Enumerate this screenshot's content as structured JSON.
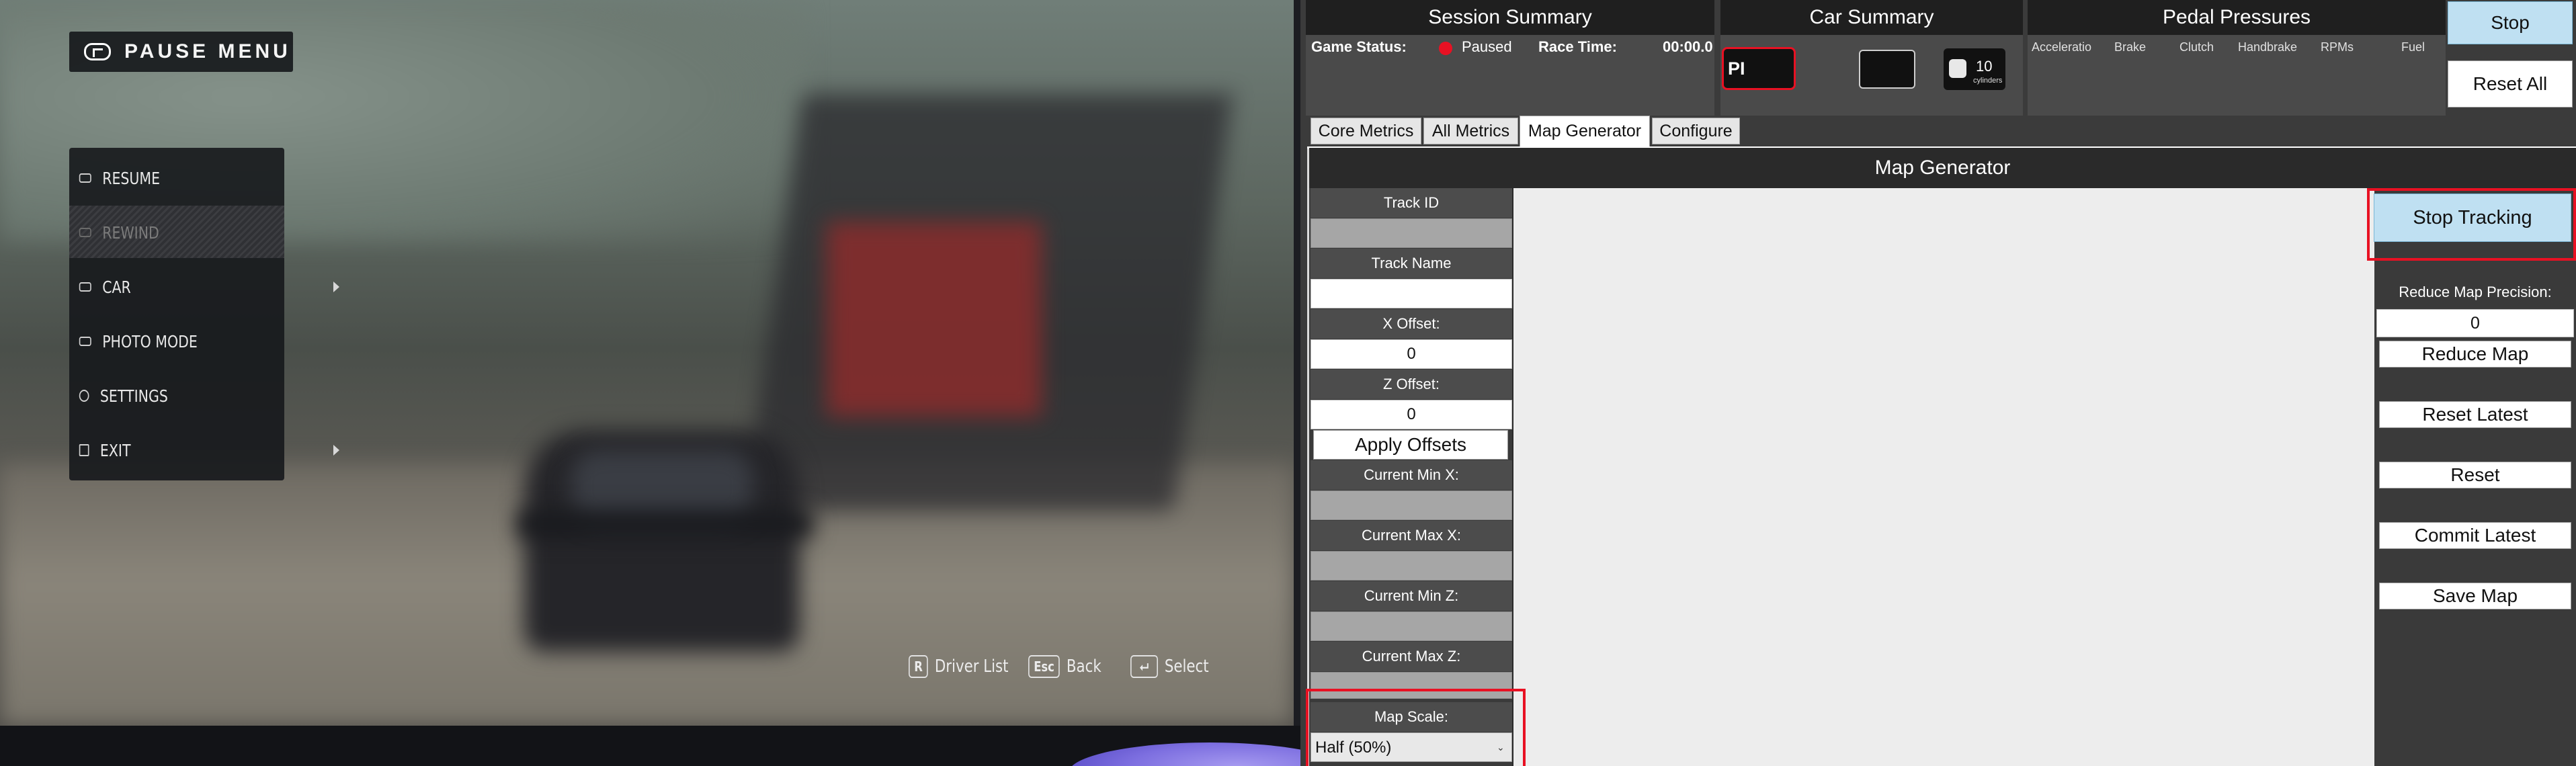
{
  "game": {
    "pause_title": "PAUSE MENU",
    "menu_items": [
      {
        "label": "RESUME",
        "icon": "gamepad-icon",
        "enabled": true,
        "submenu": false
      },
      {
        "label": "REWIND",
        "icon": "gamepad-icon",
        "enabled": false,
        "submenu": false
      },
      {
        "label": "CAR",
        "icon": "car-icon",
        "enabled": true,
        "submenu": true
      },
      {
        "label": "PHOTO MODE",
        "icon": "camera-icon",
        "enabled": true,
        "submenu": false
      },
      {
        "label": "SETTINGS",
        "icon": "gear-icon",
        "enabled": true,
        "submenu": false
      },
      {
        "label": "EXIT",
        "icon": "exit-icon",
        "enabled": true,
        "submenu": true
      }
    ],
    "hints": [
      {
        "key": "R",
        "label": "Driver List"
      },
      {
        "key": "Esc",
        "label": "Back"
      },
      {
        "key": "⮠",
        "label": "Select"
      }
    ]
  },
  "app": {
    "session": {
      "title": "Session Summary",
      "game_status_label": "Game Status:",
      "game_status_value": "Paused",
      "race_time_label": "Race Time:",
      "race_time_value": "00:00.0"
    },
    "car": {
      "title": "Car Summary",
      "pi_label": "PI",
      "cylinders_value": "10",
      "cylinders_label": "cylinders"
    },
    "pedals": {
      "title": "Pedal Pressures",
      "labels": [
        "Acceleratio",
        "Brake",
        "Clutch",
        "Handbrake",
        "RPMs",
        "Fuel"
      ]
    },
    "buttons": {
      "stop": "Stop",
      "reset_all": "Reset All"
    },
    "tabs": [
      "Core Metrics",
      "All Metrics",
      "Map Generator",
      "Configure"
    ],
    "active_tab": "Map Generator",
    "map_generator": {
      "title": "Map Generator",
      "track_id_label": "Track ID",
      "track_id_value": "",
      "track_name_label": "Track Name",
      "track_name_value": "",
      "x_offset_label": "X Offset:",
      "x_offset_value": "0",
      "z_offset_label": "Z Offset:",
      "z_offset_value": "0",
      "apply_offsets": "Apply Offsets",
      "current_min_x_label": "Current Min X:",
      "current_min_x_value": "",
      "current_max_x_label": "Current Max X:",
      "current_max_x_value": "",
      "current_min_z_label": "Current Min Z:",
      "current_min_z_value": "",
      "current_max_z_label": "Current Max Z:",
      "current_max_z_value": "",
      "map_scale_label": "Map Scale:",
      "map_scale_value": "Half (50%)",
      "stop_tracking": "Stop Tracking",
      "reduce_precision_label": "Reduce Map Precision:",
      "reduce_precision_value": "0",
      "reduce_map": "Reduce Map",
      "reset_latest": "Reset Latest",
      "reset": "Reset",
      "commit_latest": "Commit Latest",
      "save_map": "Save Map"
    }
  },
  "colors": {
    "highlight": "#e81123",
    "paused_dot": "#e81123",
    "button_blue": "#bfe0f2"
  }
}
